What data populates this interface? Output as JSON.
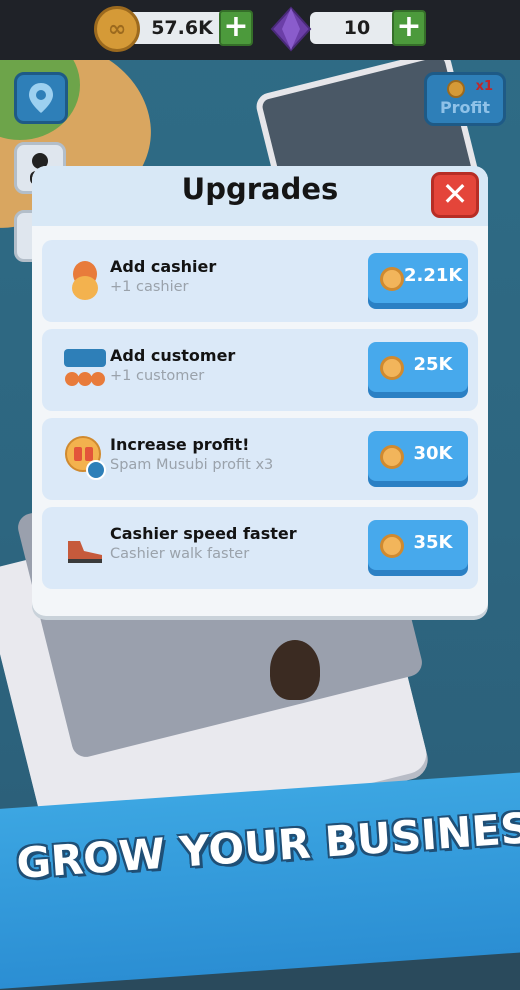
{
  "resources": {
    "coins": "57.6K",
    "gems": "10"
  },
  "hud": {
    "profit_label": "Profit",
    "profit_multiplier": "x1"
  },
  "modal": {
    "title": "Upgrades",
    "close_symbol": "✕",
    "rows": [
      {
        "title": "Add cashier",
        "subtitle": "+1 cashier",
        "price": "2.21K",
        "icon": "cashier-icon"
      },
      {
        "title": "Add customer",
        "subtitle": "+1 customer",
        "price": "25K",
        "icon": "customer-group-icon"
      },
      {
        "title": "Increase profit!",
        "subtitle": "Spam Musubi profit x3",
        "price": "30K",
        "icon": "profit-musubi-icon"
      },
      {
        "title": "Cashier speed faster",
        "subtitle": "Cashier walk faster",
        "price": "35K",
        "icon": "shoe-icon"
      }
    ]
  },
  "banner": {
    "text": "GROW YOUR BUSINESS"
  },
  "colors": {
    "accent_blue": "#47a9ec",
    "close_red": "#e4453a",
    "plus_green": "#4c9a3c"
  }
}
